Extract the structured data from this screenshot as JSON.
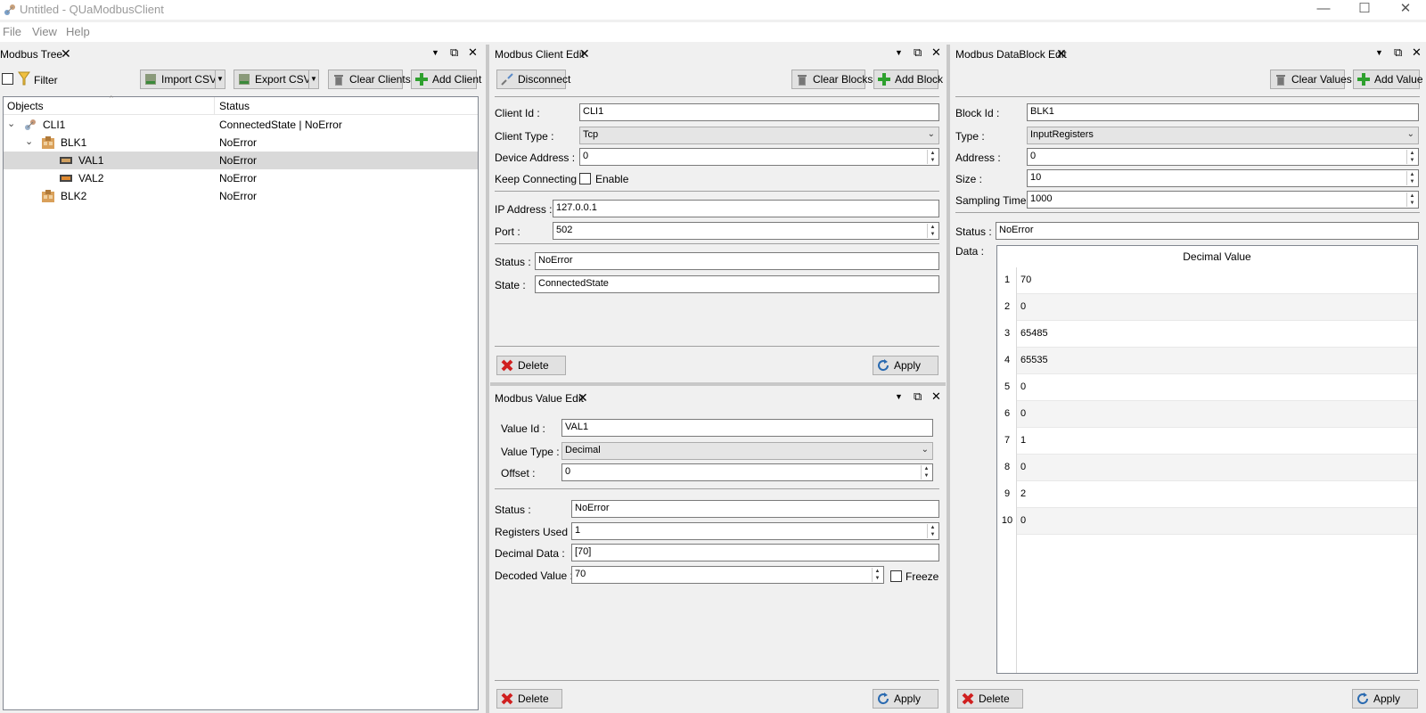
{
  "window": {
    "title": "Untitled - QUaModbusClient"
  },
  "menu": [
    "File",
    "View",
    "Help"
  ],
  "tree_panel": {
    "title": "Modbus Tree",
    "filter_label": "Filter",
    "buttons": {
      "import": "Import CSV",
      "export": "Export CSV",
      "clear": "Clear Clients",
      "add": "Add Client"
    },
    "columns": [
      "Objects",
      "Status"
    ],
    "rows": [
      {
        "name": "CLI1",
        "status": "ConnectedState | NoError"
      },
      {
        "name": "BLK1",
        "status": "NoError"
      },
      {
        "name": "VAL1",
        "status": "NoError"
      },
      {
        "name": "VAL2",
        "status": "NoError"
      },
      {
        "name": "BLK2",
        "status": "NoError"
      }
    ]
  },
  "client_panel": {
    "title": "Modbus Client Edit",
    "buttons": {
      "disconnect": "Disconnect",
      "clear": "Clear Blocks",
      "add": "Add Block",
      "delete": "Delete",
      "apply": "Apply"
    },
    "labels": {
      "client_id": "Client Id :",
      "client_type": "Client Type :",
      "device_address": "Device Address :",
      "keep_connecting": "Keep Connecting :",
      "enable": "Enable",
      "ip": "IP Address :",
      "port": "Port :",
      "status": "Status :",
      "state": "State :"
    },
    "values": {
      "client_id": "CLI1",
      "client_type": "Tcp",
      "device_address": "0",
      "ip": "127.0.0.1",
      "port": "502",
      "status": "NoError",
      "state": "ConnectedState"
    }
  },
  "value_panel": {
    "title": "Modbus Value Edit",
    "buttons": {
      "delete": "Delete",
      "apply": "Apply"
    },
    "labels": {
      "value_id": "Value Id :",
      "value_type": "Value Type :",
      "offset": "Offset :",
      "status": "Status :",
      "registers": "Registers Used :",
      "decimal_data": "Decimal Data :",
      "decoded": "Decoded Value :",
      "freeze": "Freeze"
    },
    "values": {
      "value_id": "VAL1",
      "value_type": "Decimal",
      "offset": "0",
      "status": "NoError",
      "registers": "1",
      "decimal_data": "[70]",
      "decoded": "70"
    }
  },
  "block_panel": {
    "title": "Modbus DataBlock Edit",
    "buttons": {
      "clear": "Clear Values",
      "add": "Add Value",
      "delete": "Delete",
      "apply": "Apply"
    },
    "labels": {
      "block_id": "Block Id :",
      "type": "Type :",
      "address": "Address :",
      "size": "Size :",
      "sampling": "Sampling Time :",
      "status": "Status :",
      "data": "Data :"
    },
    "values": {
      "block_id": "BLK1",
      "type": "InputRegisters",
      "address": "0",
      "size": "10",
      "sampling": "1000",
      "status": "NoError"
    },
    "table_header": "Decimal Value",
    "rows": [
      {
        "n": "1",
        "v": "70"
      },
      {
        "n": "2",
        "v": "0"
      },
      {
        "n": "3",
        "v": "65485"
      },
      {
        "n": "4",
        "v": "65535"
      },
      {
        "n": "5",
        "v": "0"
      },
      {
        "n": "6",
        "v": "0"
      },
      {
        "n": "7",
        "v": "1"
      },
      {
        "n": "8",
        "v": "0"
      },
      {
        "n": "9",
        "v": "2"
      },
      {
        "n": "10",
        "v": "0"
      }
    ]
  }
}
